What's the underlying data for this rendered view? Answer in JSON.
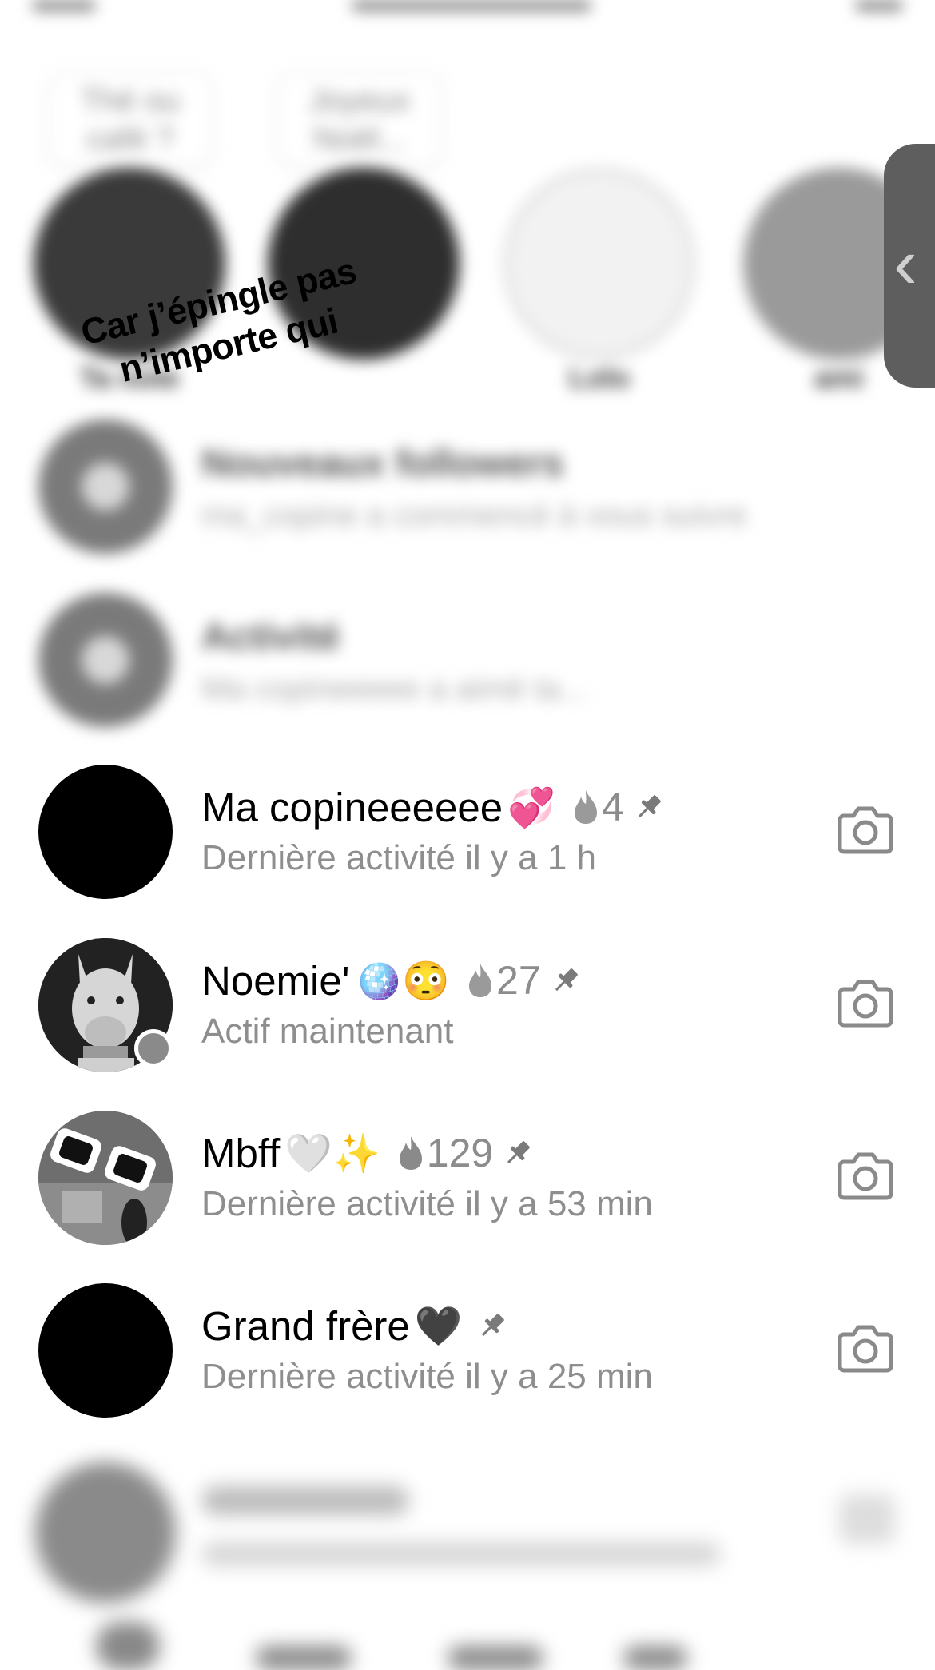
{
  "colors": {
    "background": "#ffffff",
    "primary_text": "#000000",
    "secondary_text": "#8e8e8e",
    "icon_gray": "#8a8a8a",
    "handle_gray": "#5e5e5e"
  },
  "overlay_caption": {
    "line1": "Car j’épingle pas",
    "line2": "n’importe qui"
  },
  "side_handle": {
    "icon": "chevron-left-icon"
  },
  "conversations": [
    {
      "name": "Ma copineeeeee",
      "emoji": "💞",
      "streak": "4",
      "pinned": true,
      "status": "Dernière activité il y a 1 h",
      "avatar": "black-circle",
      "online": false
    },
    {
      "name": "Noemie'",
      "emoji": "🪩😳",
      "streak": "27",
      "pinned": true,
      "status": "Actif maintenant",
      "avatar": "llama-photo",
      "online": true
    },
    {
      "name": "Mbff",
      "emoji": "🤍✨",
      "streak": "129",
      "pinned": true,
      "status": "Dernière activité il y a 53 min",
      "avatar": "sunglasses-photo",
      "online": false
    },
    {
      "name": "Grand frère",
      "emoji": "🖤",
      "streak": "",
      "pinned": true,
      "status": "Dernière activité il y a 25 min",
      "avatar": "black-circle",
      "online": false
    }
  ],
  "icons": {
    "camera": "camera-icon",
    "pin": "pin-icon",
    "flame": "flame-icon"
  }
}
